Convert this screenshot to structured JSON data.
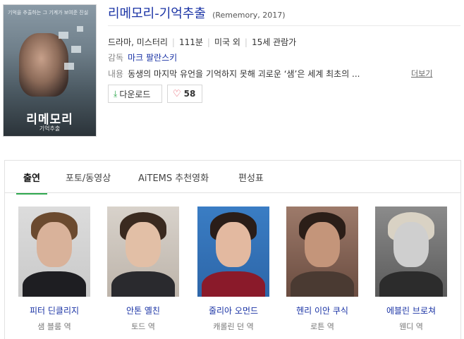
{
  "poster": {
    "tagline": "기억을 추출하는 그 기계가 보여준 진실",
    "title": "리메모리",
    "subtitle": "기억추출"
  },
  "movie": {
    "title": "리메모리-기억추출",
    "subtitle": "(Rememory, 2017)",
    "genre": "드라마, 미스터리",
    "runtime": "111분",
    "country": "미국 외",
    "rating": "15세 관람가",
    "director_label": "감독",
    "director": "마크 팔란스키",
    "synopsis_label": "내용",
    "synopsis": "동생의 마지막 유언을 기억하지 못해 괴로운 ‘샘’은 세계 최초의 ...",
    "more_label": "더보기"
  },
  "actions": {
    "download_label": "다운로드",
    "like_count": "58"
  },
  "tabs": [
    {
      "label": "출연",
      "active": true
    },
    {
      "label": "포토/동영상",
      "active": false
    },
    {
      "label": "AiTEMS 추천영화",
      "active": false
    },
    {
      "label": "편성표",
      "active": false
    }
  ],
  "cast": [
    {
      "name": "피터 딘클리지",
      "role": "샘 블룸 역"
    },
    {
      "name": "안톤 옐친",
      "role": "토드 역"
    },
    {
      "name": "줄리아 오먼드",
      "role": "캐롤린 던 역"
    },
    {
      "name": "헨리 이안 쿠식",
      "role": "로튼 역"
    },
    {
      "name": "에블린 브로쳐",
      "role": "웬디 역"
    }
  ],
  "colors": {
    "link": "#1a33a5",
    "accent_green": "#2fa84f",
    "heart": "#e03d4e"
  }
}
